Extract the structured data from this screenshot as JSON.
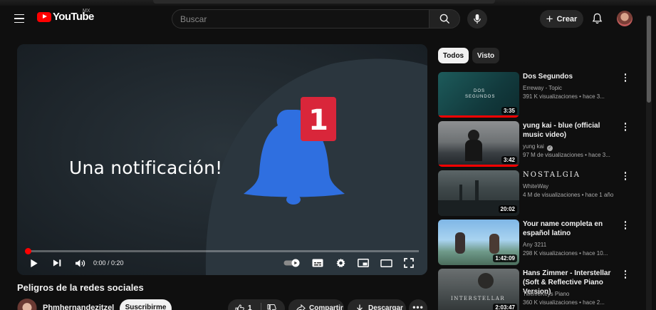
{
  "header": {
    "logo_text": "YouTube",
    "country": "MX",
    "search_placeholder": "Buscar",
    "create_label": "Crear"
  },
  "player": {
    "overlay_text": "Una notificación!",
    "badge_count": "1",
    "time": "0:00 / 0:20",
    "progress_fraction": 0.0
  },
  "video": {
    "title": "Peligros de la redes sociales",
    "channel": "Phmhernandezitzel",
    "subscribe_label": "Suscribirme",
    "likes": "1",
    "share_label": "Compartir",
    "download_label": "Descargar"
  },
  "chips": [
    "Todos",
    "Visto"
  ],
  "recommendations": [
    {
      "title": "Dos Segundos",
      "channel": "Erreway - Topic",
      "meta": "391 K visualizaciones  •  hace 3...",
      "duration": "3:35",
      "thumb_text": "DOS SEGUNDOS",
      "watched_fraction": 1.0
    },
    {
      "title": "yung kai - blue (official music video)",
      "channel": "yung kai",
      "meta": "97 M de visualizaciones  •  hace 3...",
      "duration": "3:42",
      "watched_fraction": 1.0
    },
    {
      "title": "NOSTALGIA",
      "channel": "WhiteWay",
      "meta": "4 M de visualizaciones  •  hace 1 año",
      "duration": "20:02",
      "watched_fraction": 0
    },
    {
      "title": "Your name completa en español latino",
      "channel": "Any 3211",
      "meta": "298 K visualizaciones  •  hace 10...",
      "duration": "1:42:09",
      "watched_fraction": 0
    },
    {
      "title": "Hans Zimmer - Interstellar (Soft & Reflective Piano Version)",
      "channel": "TwelveKeys Piano",
      "meta": "360 K visualizaciones  •  hace 2...",
      "duration": "2:03:47",
      "thumb_text": "INTERSTELLAR",
      "watched_fraction": 0
    }
  ],
  "colors": {
    "background": "#0f0f0f",
    "brand_red": "#ff0000",
    "bell_blue": "#2f6fe0",
    "badge_red": "#d9263a"
  }
}
